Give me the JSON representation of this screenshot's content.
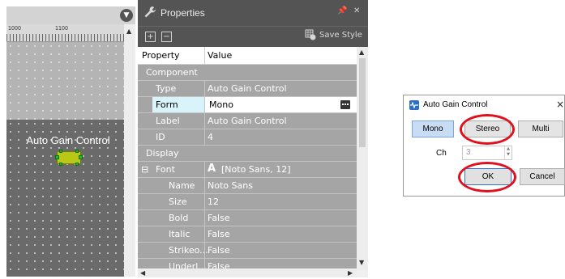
{
  "canvas": {
    "ruler_labels": [
      "1000",
      "1100"
    ],
    "component_label": "Auto Gain Control",
    "colors": {
      "block_fill": "#b8c814",
      "port": "#1cc21c"
    }
  },
  "properties_panel": {
    "title": "Properties",
    "toolbar": {
      "expand": "+",
      "collapse": "−",
      "save_style": "Save Style"
    },
    "header": {
      "property": "Property",
      "value": "Value"
    },
    "rows": [
      {
        "type": "category",
        "key": "Component"
      },
      {
        "key": "Type",
        "value": "Auto Gain Control"
      },
      {
        "key": "Form",
        "value": "Mono",
        "selected": true
      },
      {
        "key": "Label",
        "value": "Auto Gain Control"
      },
      {
        "key": "ID",
        "value": "4"
      },
      {
        "type": "category",
        "key": "Display"
      },
      {
        "key": "Font",
        "value": "[Noto Sans, 12]",
        "glyph": "A",
        "expander": "⊟"
      },
      {
        "key": "Name",
        "value": "Noto Sans"
      },
      {
        "key": "Size",
        "value": "12"
      },
      {
        "key": "Bold",
        "value": "False"
      },
      {
        "key": "Italic",
        "value": "False"
      },
      {
        "key": "Strikeo...",
        "value": "False"
      },
      {
        "key": "Underl...",
        "value": "False"
      }
    ]
  },
  "dialog": {
    "title": "Auto Gain Control",
    "close": "×",
    "modes": [
      {
        "label": "Mono",
        "active": true
      },
      {
        "label": "Stereo",
        "active": false
      },
      {
        "label": "Multi",
        "active": false
      }
    ],
    "ch_label": "Ch",
    "ch_value": "3",
    "ok": "OK",
    "cancel": "Cancel",
    "highlight_color": "#e0101c"
  }
}
